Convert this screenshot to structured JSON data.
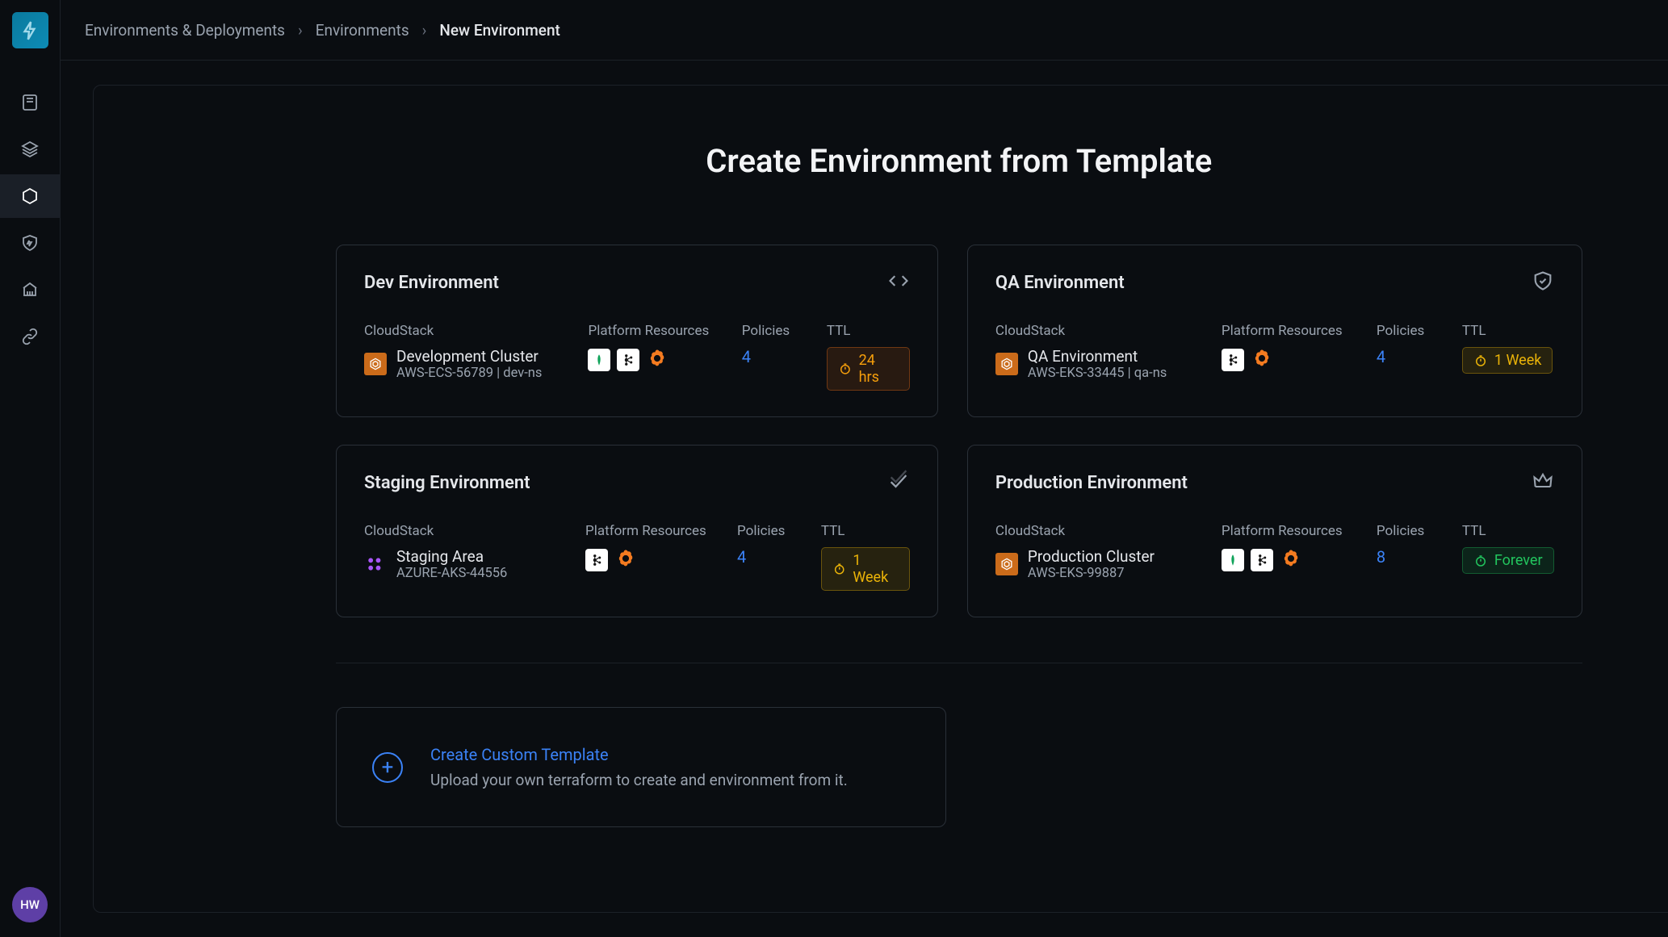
{
  "breadcrumb": {
    "root": "Environments & Deployments",
    "mid": "Environments",
    "current": "New Environment"
  },
  "avatar": "HW",
  "title": "Create Environment from Template",
  "labels": {
    "cloudstack": "CloudStack",
    "platform_resources": "Platform Resources",
    "policies": "Policies",
    "ttl": "TTL"
  },
  "templates": [
    {
      "name": "Dev Environment",
      "icon": "code",
      "cs_icon": "aws",
      "cs_name": "Development Cluster",
      "cs_sub": "AWS-ECS-56789 | dev-ns",
      "resources": [
        "mongo",
        "kafka",
        "grafana"
      ],
      "policies": "4",
      "ttl": "24 hrs",
      "ttl_class": "ttl-orange"
    },
    {
      "name": "QA Environment",
      "icon": "shield",
      "cs_icon": "aws",
      "cs_name": "QA Environment",
      "cs_sub": "AWS-EKS-33445 | qa-ns",
      "resources": [
        "kafka",
        "grafana"
      ],
      "policies": "4",
      "ttl": "1 Week",
      "ttl_class": "ttl-yellow"
    },
    {
      "name": "Staging Environment",
      "icon": "check",
      "cs_icon": "azure",
      "cs_name": "Staging Area",
      "cs_sub": "AZURE-AKS-44556",
      "resources": [
        "kafka",
        "grafana"
      ],
      "policies": "4",
      "ttl": "1 Week",
      "ttl_class": "ttl-yellow"
    },
    {
      "name": "Production Environment",
      "icon": "crown",
      "cs_icon": "aws",
      "cs_name": "Production Cluster",
      "cs_sub": "AWS-EKS-99887",
      "resources": [
        "mongo",
        "kafka",
        "grafana"
      ],
      "policies": "8",
      "ttl": "Forever",
      "ttl_class": "ttl-green"
    }
  ],
  "custom": {
    "title": "Create Custom Template",
    "sub": "Upload your own terraform to create and environment from it."
  }
}
